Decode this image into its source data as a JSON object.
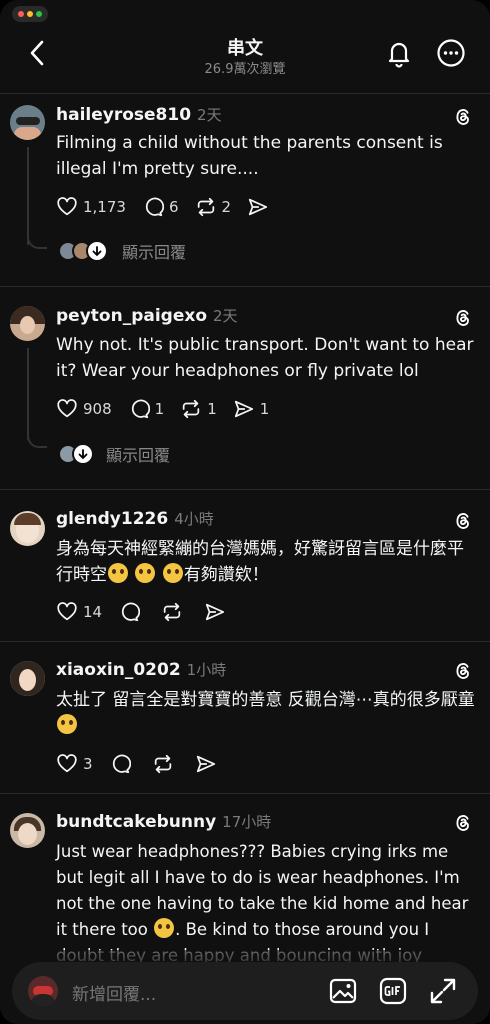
{
  "header": {
    "title": "串文",
    "subtitle": "26.9萬次瀏覽"
  },
  "posts": [
    {
      "username": "haileyrose810",
      "time": "2天",
      "text": "Filming a child without the parents consent is illegal I'm pretty sure....",
      "likes": "1,173",
      "comments": "6",
      "reposts": "2",
      "shares": "",
      "replies_label": "顯示回覆"
    },
    {
      "username": "peyton_paigexo",
      "time": "2天",
      "text": "Why not. It's public transport. Don't want to hear it? Wear your headphones or fly private lol",
      "likes": "908",
      "comments": "1",
      "reposts": "1",
      "shares": "1",
      "replies_label": "顯示回覆"
    },
    {
      "username": "glendy1226",
      "time": "4小時",
      "text_before": "身為每天神經緊繃的台灣媽媽，好驚訝留言區是什麼平行時空",
      "text_after": "有夠讚欸！",
      "likes": "14"
    },
    {
      "username": "xiaoxin_0202",
      "time": "1小時",
      "text_before": "太扯了 留言全是對寶寶的善意 反觀台灣⋯真的很多厭童",
      "likes": "3"
    },
    {
      "username": "bundtcakebunny",
      "time": "17小時",
      "text_before": "Just wear headphones??? Babies crying irks me but legit all I have to do is wear headphones. I'm not the one having to take the kid home and hear it there too",
      "text_after": ". Be kind to those around you I doubt they are happy and bouncing with joy"
    }
  ],
  "composer": {
    "placeholder": "新增回覆..."
  },
  "icons": {
    "back": "chevron-left-icon",
    "bell": "bell-icon",
    "more": "more-icon",
    "threads": "threads-icon",
    "like": "heart-icon",
    "comment": "comment-icon",
    "repost": "repost-icon",
    "share": "share-icon",
    "image": "image-icon",
    "gif": "gif-icon",
    "expand": "expand-icon"
  }
}
